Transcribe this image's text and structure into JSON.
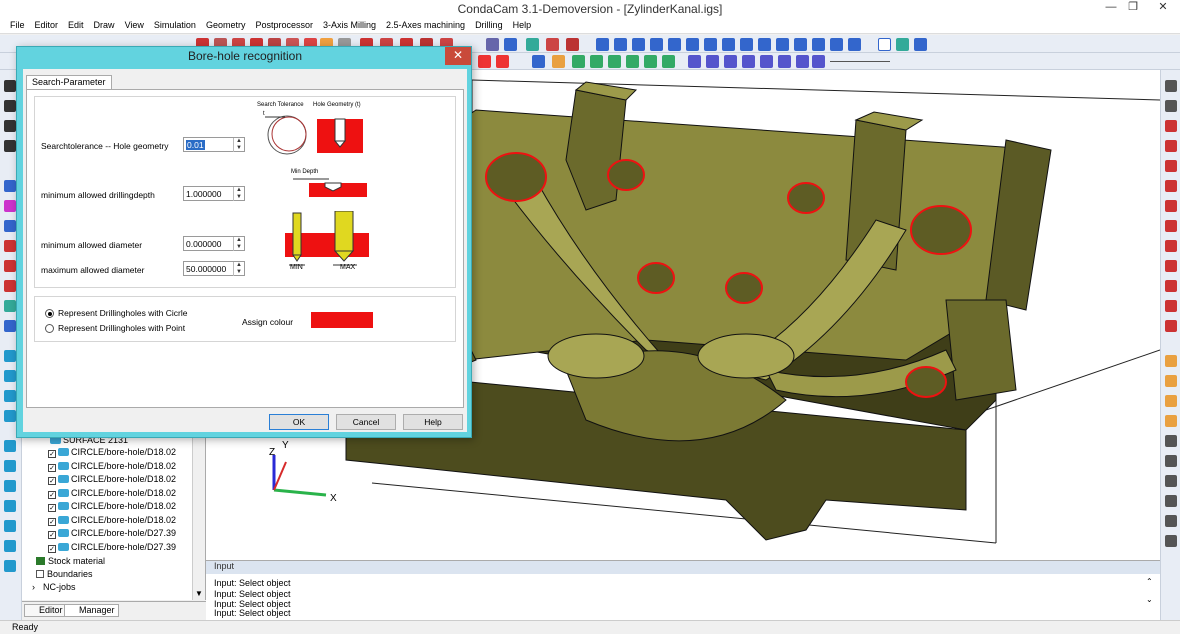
{
  "window": {
    "title": "CondaCam 3.1-Demoversion - [ZylinderKanal.igs]"
  },
  "menu": [
    "File",
    "Editor",
    "Edit",
    "Draw",
    "View",
    "Simulation",
    "Geometry",
    "Postprocessor",
    "3-Axis Milling",
    "2.5-Axes machining",
    "Drilling",
    "Help"
  ],
  "dialog": {
    "title": "Bore-hole recognition",
    "tab": "Search-Parameter",
    "labels": {
      "search_tolerance": "Searchtolerance -- Hole geometry",
      "min_depth": "minimum allowed drillingdepth",
      "min_diameter": "minimum allowed diameter",
      "max_diameter": "maximum allowed diameter"
    },
    "values": {
      "search_tolerance": "0.01",
      "min_depth": "1.000000",
      "min_diameter": "0.000000",
      "max_diameter": "50.000000"
    },
    "diagram_labels": {
      "search_tolerance": "Search Tolerance",
      "hole_geometry": "Hole Geometry (t)",
      "t": "t",
      "min_depth": "Min Depth",
      "min": "MIN",
      "max": "MAX"
    },
    "radio": {
      "circle": "Represent Drillingholes with Cicrle",
      "point": "Represent Drillingholes with Point"
    },
    "assign_colour": "Assign colour",
    "colour": "#ee1111",
    "buttons": {
      "ok": "OK",
      "cancel": "Cancel",
      "help": "Help"
    }
  },
  "tree": {
    "items": [
      "SURFACE 2131",
      "CIRCLE/bore-hole/D18.02",
      "CIRCLE/bore-hole/D18.02",
      "CIRCLE/bore-hole/D18.02",
      "CIRCLE/bore-hole/D18.02",
      "CIRCLE/bore-hole/D18.02",
      "CIRCLE/bore-hole/D18.02",
      "CIRCLE/bore-hole/D27.39",
      "CIRCLE/bore-hole/D27.39"
    ],
    "stock": "Stock material",
    "boundaries": "Boundaries",
    "ncjobs": "NC-jobs",
    "tabs": {
      "editor": "Editor",
      "manager": "Manager"
    }
  },
  "input_panel": {
    "title": "Input",
    "lines": [
      "Input: Select object",
      "Input: Select object",
      "Input: Select object",
      "Input: Select object"
    ]
  },
  "status": "Ready",
  "axes": {
    "z": "Z",
    "y": "Y",
    "x": "X"
  },
  "colors": {
    "part": "#8c8a3e",
    "hole_outline": "#ee1111",
    "dialog_frame": "#62d3df"
  }
}
